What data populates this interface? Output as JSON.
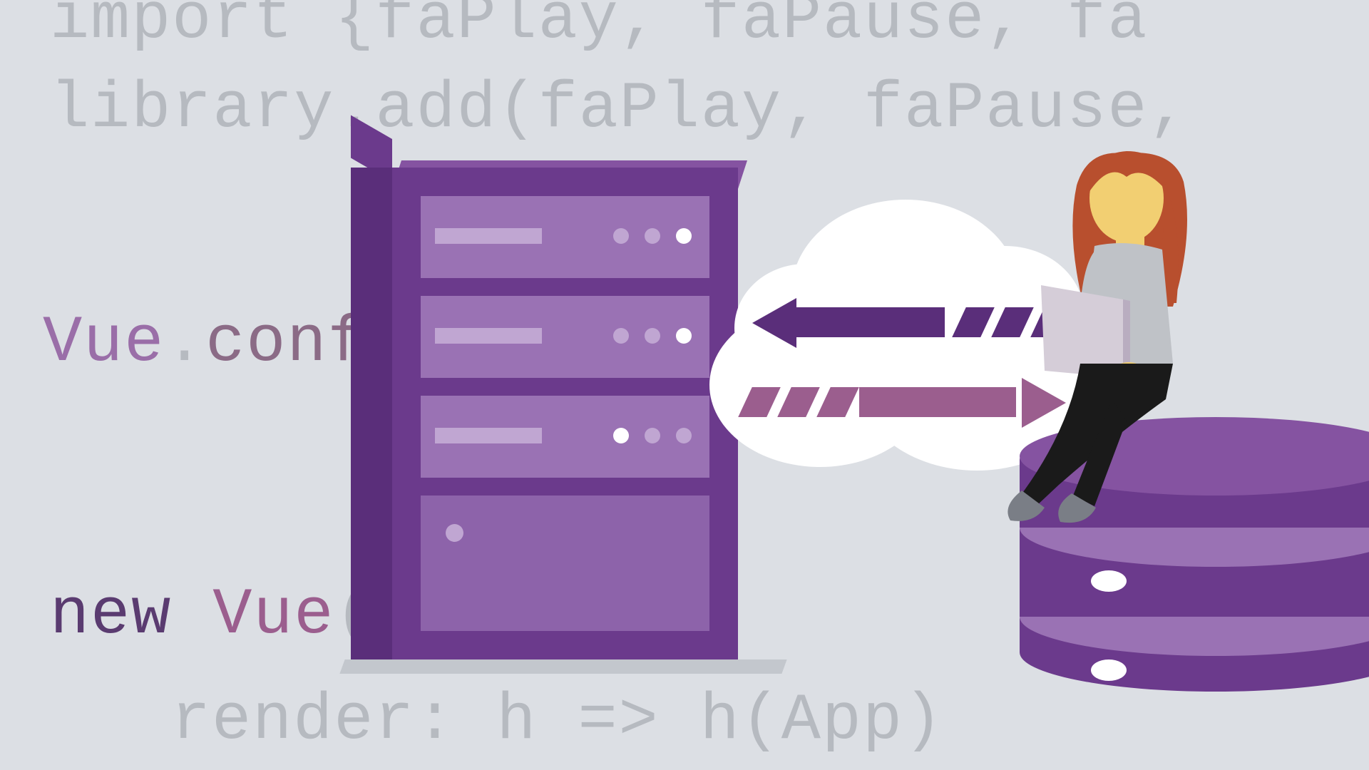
{
  "code": {
    "line1": "import {faPlay, faPause, fa",
    "line2": "library.add(faPlay, faPause,",
    "line3_vue": "Vue",
    "line3_dot": ".",
    "line3_conf": "conf",
    "line4_new": "new ",
    "line4_vue": "Vue",
    "line4_paren": "(",
    "line5": "render: h => h(App)"
  },
  "colors": {
    "background": "#dcdfe4",
    "code_gray": "#b6bac0",
    "purple_dark": "#5a2e7a",
    "purple_mid": "#6b3a8c",
    "purple_light": "#9a72b4",
    "mauve": "#9b5e8e"
  }
}
